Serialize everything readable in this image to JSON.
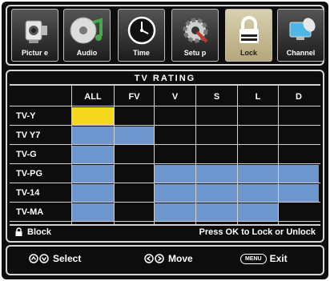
{
  "tabs": [
    {
      "label": "Pictur e",
      "icon": "camcorder-icon",
      "active": false
    },
    {
      "label": "Audio",
      "icon": "music-disc-icon",
      "active": false
    },
    {
      "label": "Time",
      "icon": "clock-icon",
      "active": false
    },
    {
      "label": "Setu p",
      "icon": "setup-gear-icon",
      "active": false
    },
    {
      "label": "Lock",
      "icon": "padlock-icon",
      "active": true
    },
    {
      "label": "Channel",
      "icon": "satellite-dish-icon",
      "active": false
    }
  ],
  "title": "TV RATING",
  "columns": [
    "ALL",
    "FV",
    "V",
    "S",
    "L",
    "D"
  ],
  "rows": [
    {
      "label": "TV-Y",
      "cells": [
        "selected",
        "empty",
        "empty",
        "empty",
        "empty",
        "empty"
      ]
    },
    {
      "label": "TV Y7",
      "cells": [
        "blocked",
        "blocked",
        "empty",
        "empty",
        "empty",
        "empty"
      ]
    },
    {
      "label": "TV-G",
      "cells": [
        "blocked",
        "empty",
        "empty",
        "empty",
        "empty",
        "empty"
      ]
    },
    {
      "label": "TV-PG",
      "cells": [
        "blocked",
        "empty",
        "blocked",
        "blocked",
        "blocked",
        "blocked"
      ]
    },
    {
      "label": "TV-14",
      "cells": [
        "blocked",
        "empty",
        "blocked",
        "blocked",
        "blocked",
        "blocked"
      ]
    },
    {
      "label": "TV-MA",
      "cells": [
        "blocked",
        "empty",
        "blocked",
        "blocked",
        "blocked",
        "empty"
      ]
    }
  ],
  "colors": {
    "selected": "#f4d81e",
    "blocked": "#6f97cf",
    "empty": "#0d0d0d"
  },
  "block_label": "Block",
  "hint": "Press OK to Lock or Unlock",
  "footer": {
    "select_label": "Select",
    "move_label": "Move",
    "menu_key": "MENU",
    "exit_label": "Exit"
  }
}
